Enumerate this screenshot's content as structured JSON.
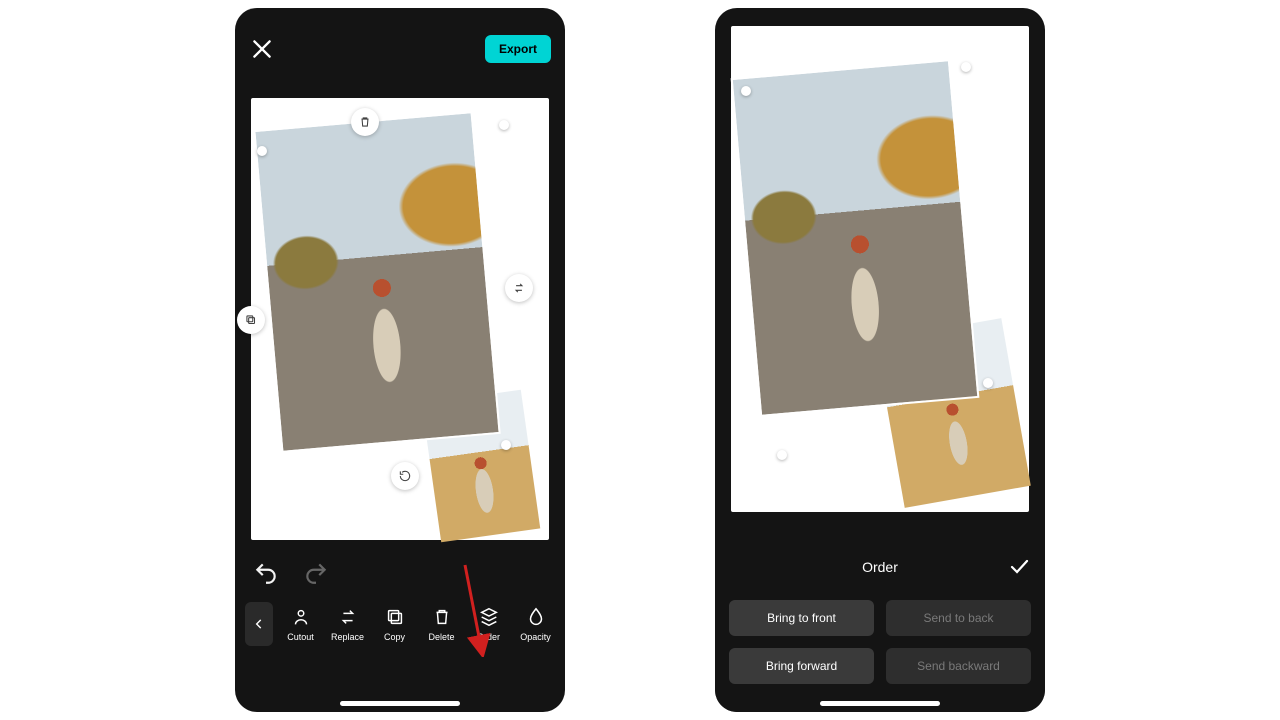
{
  "left": {
    "export_label": "Export",
    "tools": {
      "cutout": "Cutout",
      "replace": "Replace",
      "copy": "Copy",
      "delete": "Delete",
      "order": "Order",
      "opacity": "Opacity"
    },
    "handles": {
      "trash": "trash-icon",
      "swap": "swap-icon",
      "duplicate": "duplicate-icon",
      "rotate": "rotate-icon"
    }
  },
  "right": {
    "sheet_title": "Order",
    "buttons": {
      "bring_front": "Bring to front",
      "send_back": "Send to back",
      "bring_forward": "Bring forward",
      "send_backward": "Send backward"
    }
  }
}
